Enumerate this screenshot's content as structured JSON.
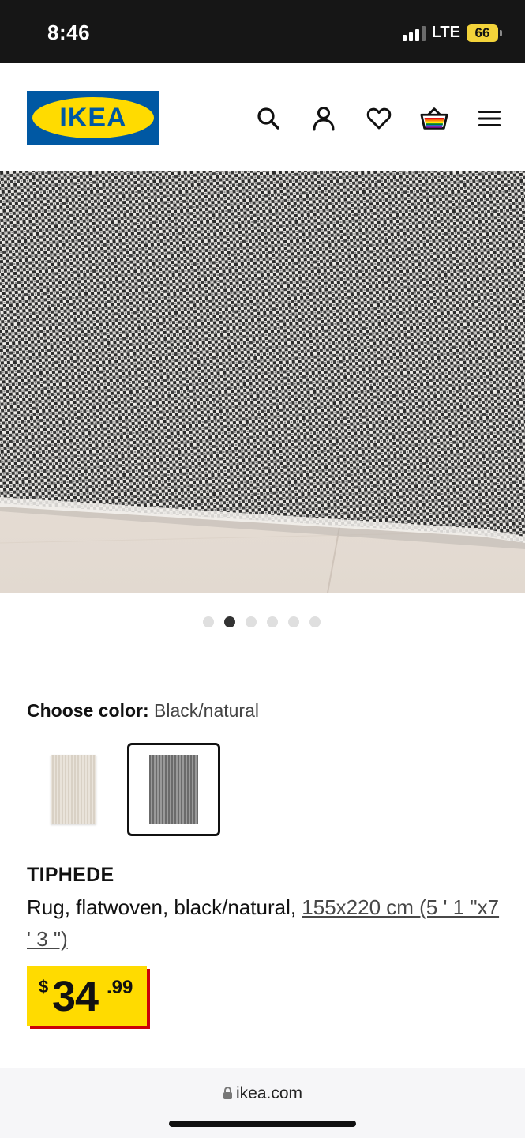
{
  "status_bar": {
    "time": "8:46",
    "network": "LTE",
    "battery": "66"
  },
  "header": {
    "logo_text": "IKEA",
    "icons": [
      "search-icon",
      "profile-icon",
      "heart-icon",
      "basket-icon",
      "menu-icon"
    ],
    "brand_colors": {
      "blue": "#0058a3",
      "yellow": "#ffdb00"
    }
  },
  "carousel": {
    "total": 6,
    "active_index": 1
  },
  "color_selector": {
    "label": "Choose color:",
    "selected_value": "Black/natural",
    "options": [
      "white-natural-swatch",
      "black-natural-swatch"
    ],
    "selected_index": 1
  },
  "product": {
    "name": "TIPHEDE",
    "description": "Rug, flatwoven, black/natural, ",
    "size_link": "155x220 cm (5 ' 1 \"x7 ' 3 \")",
    "price": {
      "currency": "$",
      "integer": "34",
      "decimal": ".99"
    }
  },
  "browser": {
    "url": "ikea.com"
  }
}
